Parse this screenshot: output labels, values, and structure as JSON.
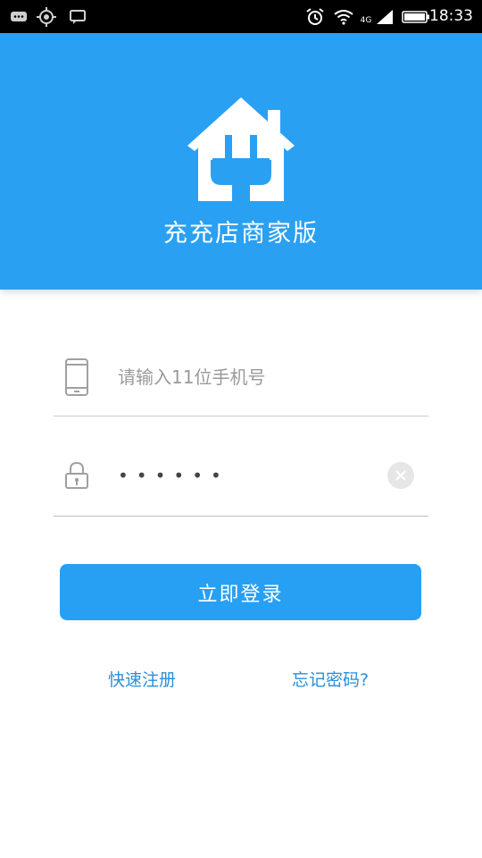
{
  "status_bar": {
    "time": "18:33",
    "network_label": "4G",
    "icons": [
      "chat-bubble-icon",
      "location-target-icon",
      "message-icon",
      "alarm-icon",
      "wifi-icon",
      "signal-icon",
      "battery-icon"
    ]
  },
  "header": {
    "title": "充充店商家版",
    "logo_icon": "house-plug-icon",
    "bg_color": "#2aa0f2"
  },
  "login_form": {
    "phone": {
      "placeholder": "请输入11位手机号",
      "value": "",
      "icon": "phone-icon"
    },
    "password": {
      "masked_value": "••••••",
      "icon": "lock-icon",
      "clear_icon": "clear-icon"
    },
    "submit_label": "立即登录"
  },
  "links": {
    "register": "快速注册",
    "forgot_password": "忘记密码?"
  },
  "colors": {
    "primary": "#27a0f4",
    "link": "#2a8fd9"
  }
}
